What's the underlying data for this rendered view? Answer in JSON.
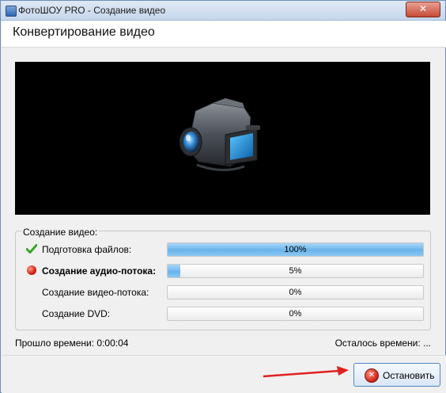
{
  "window": {
    "title": "ФотоШОУ PRO - Создание видео",
    "close_label": "✕"
  },
  "header": {
    "title": "Конвертирование видео"
  },
  "preview": {
    "icon": "camcorder-icon"
  },
  "progress": {
    "group_title": "Создание видео:",
    "rows": [
      {
        "label": "Подготовка файлов:",
        "value": "100%",
        "fraction": 1.0,
        "status": "done",
        "icon": "check-icon",
        "bold": false
      },
      {
        "label": "Создание аудио-потока:",
        "value": "5%",
        "fraction": 0.05,
        "status": "active",
        "icon": "red-dot-icon",
        "bold": true
      },
      {
        "label": "Создание видео-потока:",
        "value": "0%",
        "fraction": 0.0,
        "status": "pending",
        "icon": "",
        "bold": false
      },
      {
        "label": "Создание DVD:",
        "value": "0%",
        "fraction": 0.0,
        "status": "pending",
        "icon": "",
        "bold": false
      }
    ]
  },
  "status": {
    "elapsed": "Прошло времени: 0:00:04",
    "remaining": "Осталось времени: ..."
  },
  "footer": {
    "stop_label": "Остановить"
  },
  "colors": {
    "progress_fill": "#6ab4ec",
    "accent_arrow": "#e02020",
    "check": "#3aa52a",
    "active_dot": "#d41f12"
  }
}
